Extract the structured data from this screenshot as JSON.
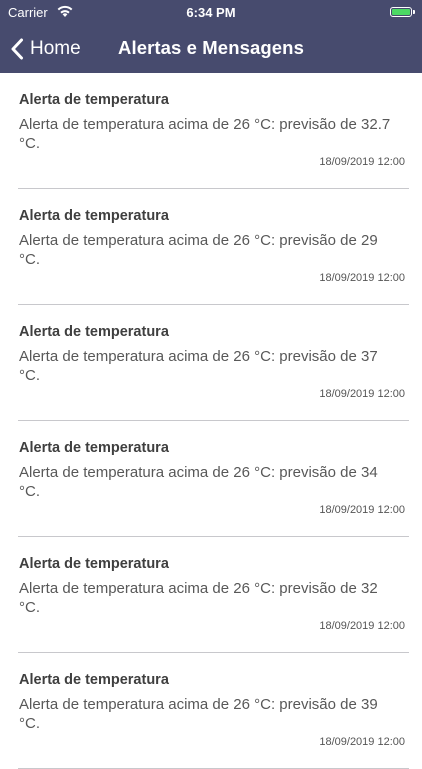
{
  "status_bar": {
    "carrier": "Carrier",
    "time": "6:34 PM",
    "battery_color": "#4cd964"
  },
  "nav_bar": {
    "back_label": "Home",
    "title": "Alertas e Mensagens",
    "background": "#474b6e"
  },
  "alerts": [
    {
      "title": "Alerta de temperatura",
      "body": "Alerta de temperatura acima de 26 °C: previsão de 32.7 °C.",
      "date": "18/09/2019 12:00"
    },
    {
      "title": "Alerta de temperatura",
      "body": "Alerta de temperatura acima de 26 °C: previsão de 29 °C.",
      "date": "18/09/2019 12:00"
    },
    {
      "title": "Alerta de temperatura",
      "body": "Alerta de temperatura acima de 26 °C: previsão de 37 °C.",
      "date": "18/09/2019 12:00"
    },
    {
      "title": "Alerta de temperatura",
      "body": "Alerta de temperatura acima de 26 °C: previsão de 34 °C.",
      "date": "18/09/2019 12:00"
    },
    {
      "title": "Alerta de temperatura",
      "body": "Alerta de temperatura acima de 26 °C: previsão de 32 °C.",
      "date": "18/09/2019 12:00"
    },
    {
      "title": "Alerta de temperatura",
      "body": "Alerta de temperatura acima de 26 °C: previsão de 39 °C.",
      "date": "18/09/2019 12:00"
    }
  ]
}
